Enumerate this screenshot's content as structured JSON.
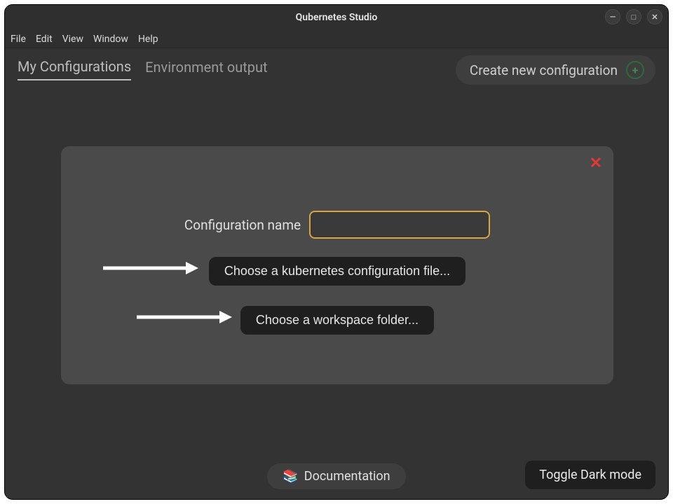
{
  "window": {
    "title": "Qubernetes Studio"
  },
  "menubar": {
    "file": "File",
    "edit": "Edit",
    "view": "View",
    "window": "Window",
    "help": "Help"
  },
  "tabs": {
    "my_configurations": "My Configurations",
    "environment_output": "Environment output"
  },
  "create_button": "Create new configuration",
  "dialog": {
    "config_name_label": "Configuration name",
    "config_name_value": "",
    "choose_kube_file": "Choose a kubernetes configuration file...",
    "choose_workspace": "Choose a workspace folder..."
  },
  "footer": {
    "documentation": "Documentation",
    "toggle_dark": "Toggle Dark mode"
  },
  "icons": {
    "plus": "+",
    "close": "✕",
    "books": "📚",
    "minimize": "—",
    "maximize": "□",
    "window_close": "✕"
  }
}
